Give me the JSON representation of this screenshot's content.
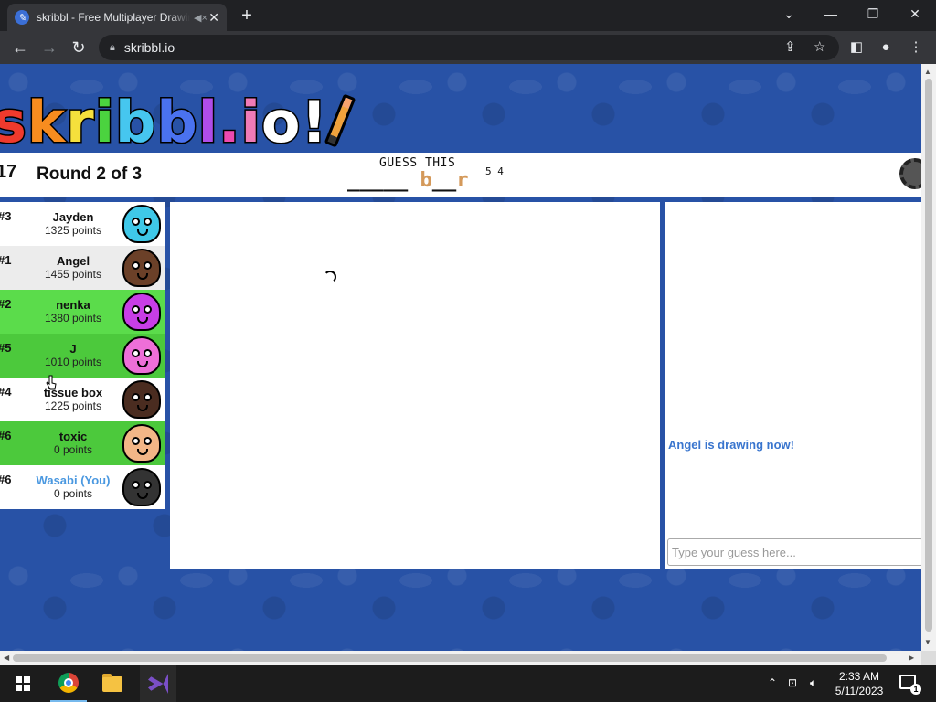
{
  "browser": {
    "tab_title": "skribbl - Free Multiplayer Drawing & Guessing Game",
    "url": "skribbl.io"
  },
  "logo_text": "skribbl.io",
  "game": {
    "timer": "17",
    "round": "Round 2 of 3",
    "guess_label": "GUESS THIS",
    "word_hidden_part": "_____ ",
    "word_hint_1": "b",
    "word_mid": "__",
    "word_hint_2": "r",
    "word_lengths": "5 4"
  },
  "players": [
    {
      "rank": "#3",
      "name": "Jayden",
      "score": "1325 points",
      "style": "white",
      "avatar_color": "#3fc8e8"
    },
    {
      "rank": "#1",
      "name": "Angel",
      "score": "1455 points",
      "style": "alt",
      "avatar_color": "#6b4028"
    },
    {
      "rank": "#2",
      "name": "nenka",
      "score": "1380 points",
      "style": "guessed",
      "avatar_color": "#c83ee6"
    },
    {
      "rank": "#5",
      "name": "J",
      "score": "1010 points",
      "style": "guessed-alt",
      "avatar_color": "#ee6fd8"
    },
    {
      "rank": "#4",
      "name": "tissue box",
      "score": "1225 points",
      "style": "white",
      "avatar_color": "#4a2c20"
    },
    {
      "rank": "#6",
      "name": "toxic",
      "score": "0 points",
      "style": "guessed-alt",
      "avatar_color": "#f2b687"
    },
    {
      "rank": "#6",
      "name": "Wasabi (You)",
      "score": "0 points",
      "style": "white-you",
      "avatar_color": "#333333"
    }
  ],
  "chat": {
    "message": "Angel is drawing now!",
    "input_placeholder": "Type your guess here..."
  },
  "taskbar": {
    "time": "2:33 AM",
    "date": "5/11/2023",
    "notification_count": "1"
  },
  "colors": {
    "page_bg": "#2852a6",
    "guessed_green": "#5bdc4b",
    "chat_system_blue": "#3975ce",
    "hint_orange": "#d4995a",
    "you_blue": "#4a98e0"
  }
}
